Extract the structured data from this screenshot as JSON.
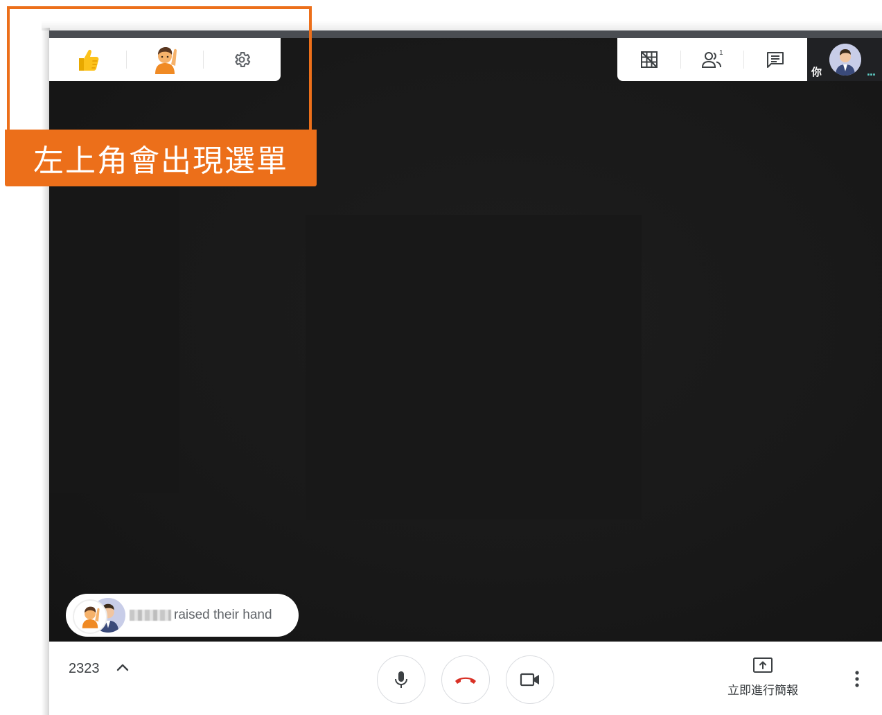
{
  "annotation": {
    "text": "左上角會出現選單",
    "color": "#ec6f1a"
  },
  "left_toolbar": {
    "buttons": [
      {
        "icon": "thumbs-up-icon"
      },
      {
        "icon": "raised-hand-icon"
      },
      {
        "icon": "gear-icon"
      }
    ]
  },
  "right_toolbar": {
    "buttons": [
      {
        "icon": "layout-grid-icon"
      },
      {
        "icon": "people-icon",
        "count": "1"
      },
      {
        "icon": "chat-icon"
      }
    ]
  },
  "self_tile": {
    "label": "你",
    "more": "..."
  },
  "toast": {
    "text": "raised their hand"
  },
  "bottom_bar": {
    "meeting_code": "2323",
    "present_label": "立即進行簡報",
    "colors": {
      "hangup": "#d93025",
      "icon": "#3c4043"
    }
  }
}
